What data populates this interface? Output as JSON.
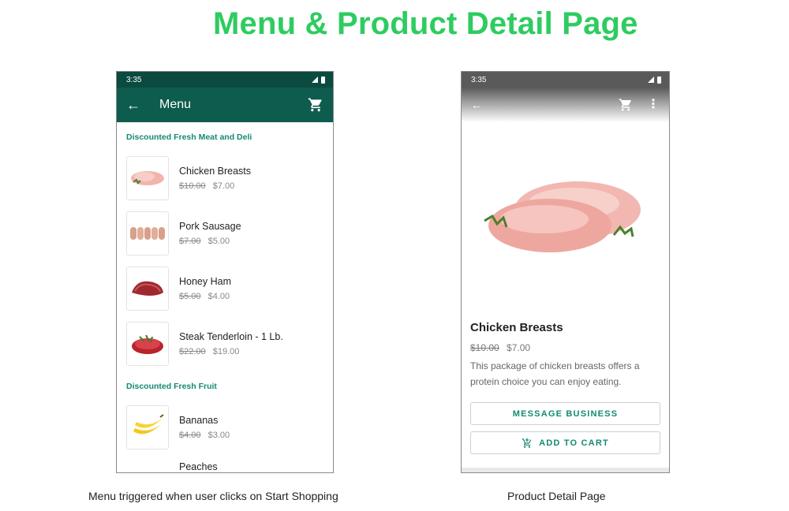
{
  "heading": "Menu & Product Detail Page",
  "menu_screen": {
    "status_time": "3:35",
    "title": "Menu",
    "sections": [
      {
        "label": "Discounted Fresh Meat and Deli",
        "items": [
          {
            "name": "Chicken Breasts",
            "old_price": "$10.00",
            "price": "$7.00"
          },
          {
            "name": "Pork Sausage",
            "old_price": "$7.00",
            "price": "$5.00"
          },
          {
            "name": "Honey Ham",
            "old_price": "$5.00",
            "price": "$4.00"
          },
          {
            "name": "Steak Tenderloin - 1 Lb.",
            "old_price": "$22.00",
            "price": "$19.00"
          }
        ]
      },
      {
        "label": "Discounted Fresh Fruit",
        "items": [
          {
            "name": "Bananas",
            "old_price": "$4.00",
            "price": "$3.00"
          },
          {
            "name": "Peaches"
          }
        ]
      }
    ]
  },
  "detail_screen": {
    "status_time": "3:35",
    "product_name": "Chicken Breasts",
    "old_price": "$10.00",
    "price": "$7.00",
    "description": "This package of chicken breasts offers a protein choice you can enjoy eating.",
    "message_button": "MESSAGE BUSINESS",
    "cart_button": "ADD TO CART"
  },
  "captions": {
    "left": "Menu triggered when user clicks on Start Shopping",
    "right": "Product Detail Page"
  },
  "colors": {
    "heading": "#2ecc60",
    "appbar": "#0e5c4d",
    "status_bar": "#0b4a3e",
    "accent_text": "#138a72"
  },
  "icons": [
    "back-arrow-icon",
    "cart-icon",
    "more-vert-icon",
    "add-cart-icon",
    "signal-icon",
    "battery-icon"
  ]
}
